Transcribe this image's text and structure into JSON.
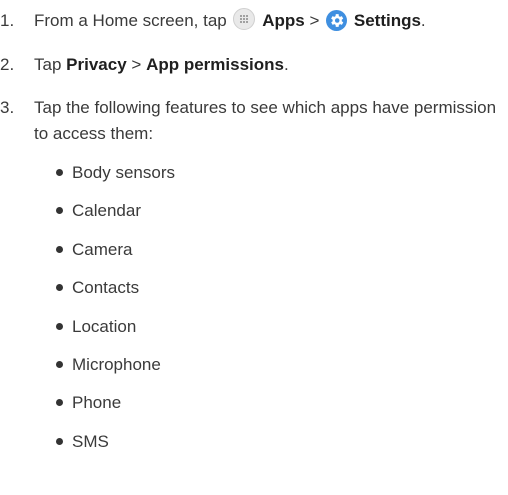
{
  "steps": [
    {
      "number": "1.",
      "prefix": "From a Home screen, tap",
      "apps_label": "Apps",
      "separator": ">",
      "settings_label": "Settings",
      "end": ".",
      "apps_icon": "apps-grid-icon",
      "settings_icon": "gear-icon"
    },
    {
      "number": "2.",
      "prefix": "Tap",
      "privacy_label": "Privacy",
      "separator": ">",
      "permissions_label": "App permissions",
      "end": "."
    },
    {
      "number": "3.",
      "text": "Tap the following features to see which apps have permission to access them:"
    }
  ],
  "features": [
    "Body sensors",
    "Calendar",
    "Camera",
    "Contacts",
    "Location",
    "Microphone",
    "Phone",
    "SMS"
  ],
  "colors": {
    "text": "#3a3a3a",
    "settings_icon": "#3f8fe0"
  }
}
